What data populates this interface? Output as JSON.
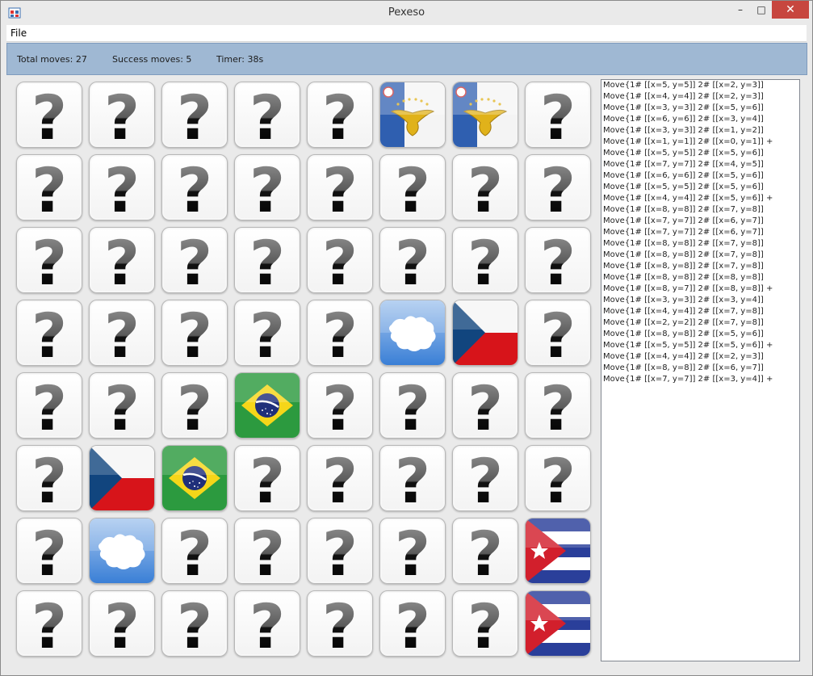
{
  "window": {
    "title": "Pexeso",
    "minimize_glyph": "–",
    "maximize_glyph": "□",
    "close_glyph": "✕"
  },
  "menu": {
    "file": "File"
  },
  "status": {
    "total_moves": "Total moves:  27",
    "success_moves": "Success moves:  5",
    "timer": "Timer:   38s"
  },
  "board": {
    "rows": 8,
    "cols": 8,
    "back_icon": "question-mark-icon",
    "revealed": [
      {
        "row": 1,
        "col": 6,
        "card": "azores-flag"
      },
      {
        "row": 1,
        "col": 7,
        "card": "azores-flag"
      },
      {
        "row": 4,
        "col": 6,
        "card": "antarctica-flag"
      },
      {
        "row": 4,
        "col": 7,
        "card": "czech-flag"
      },
      {
        "row": 5,
        "col": 4,
        "card": "brazil-flag"
      },
      {
        "row": 6,
        "col": 2,
        "card": "czech-flag"
      },
      {
        "row": 6,
        "col": 3,
        "card": "brazil-flag"
      },
      {
        "row": 7,
        "col": 2,
        "card": "antarctica-flag"
      },
      {
        "row": 7,
        "col": 8,
        "card": "cuba-flag"
      },
      {
        "row": 8,
        "col": 8,
        "card": "cuba-flag"
      }
    ]
  },
  "log": [
    "Move{1# [[x=5, y=5]] 2# [[x=2, y=3]]",
    "Move{1# [[x=4, y=4]] 2# [[x=2, y=3]]",
    "Move{1# [[x=3, y=3]] 2# [[x=5, y=6]]",
    "Move{1# [[x=6, y=6]] 2# [[x=3, y=4]]",
    "Move{1# [[x=3, y=3]] 2# [[x=1, y=2]]",
    "Move{1# [[x=1, y=1]] 2# [[x=0, y=1]] +",
    "Move{1# [[x=5, y=5]] 2# [[x=5, y=6]]",
    "Move{1# [[x=7, y=7]] 2# [[x=4, y=5]]",
    "Move{1# [[x=6, y=6]] 2# [[x=5, y=6]]",
    "Move{1# [[x=5, y=5]] 2# [[x=5, y=6]]",
    "Move{1# [[x=4, y=4]] 2# [[x=5, y=6]] +",
    "Move{1# [[x=8, y=8]] 2# [[x=7, y=8]]",
    "Move{1# [[x=7, y=7]] 2# [[x=6, y=7]]",
    "Move{1# [[x=7, y=7]] 2# [[x=6, y=7]]",
    "Move{1# [[x=8, y=8]] 2# [[x=7, y=8]]",
    "Move{1# [[x=8, y=8]] 2# [[x=7, y=8]]",
    "Move{1# [[x=8, y=8]] 2# [[x=7, y=8]]",
    "Move{1# [[x=8, y=8]] 2# [[x=8, y=8]]",
    "Move{1# [[x=8, y=7]] 2# [[x=8, y=8]] +",
    "Move{1# [[x=3, y=3]] 2# [[x=3, y=4]]",
    "Move{1# [[x=4, y=4]] 2# [[x=7, y=8]]",
    "Move{1# [[x=2, y=2]] 2# [[x=7, y=8]]",
    "Move{1# [[x=8, y=8]] 2# [[x=5, y=6]]",
    "Move{1# [[x=5, y=5]] 2# [[x=5, y=6]] +",
    "Move{1# [[x=4, y=4]] 2# [[x=2, y=3]]",
    "Move{1# [[x=8, y=8]] 2# [[x=6, y=7]]",
    "Move{1# [[x=7, y=7]] 2# [[x=3, y=4]] +"
  ]
}
